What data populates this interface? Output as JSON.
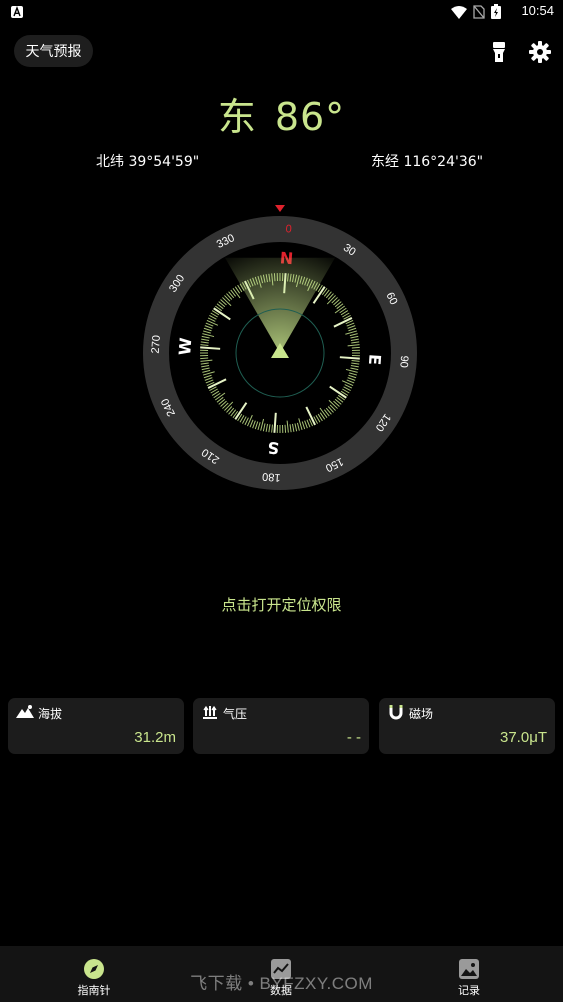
{
  "status_bar": {
    "time": "10:54"
  },
  "header": {
    "weather_label": "天气预报",
    "direction": "东",
    "degrees": "86°"
  },
  "coords": {
    "latitude": "北纬 39°54'59\"",
    "longitude": "东经 116°24'36\""
  },
  "compass": {
    "heading_deg": 86,
    "ring_numbers": [
      "0",
      "30",
      "60",
      "90",
      "120",
      "150",
      "180",
      "210",
      "240",
      "270",
      "300",
      "330"
    ],
    "cardinals": {
      "north": "N",
      "east": "E",
      "south": "S",
      "west": "W"
    }
  },
  "permission_text": "点击打开定位权限",
  "cards": [
    {
      "label": "海拔",
      "value": "31.2m",
      "icon": "mountain-icon"
    },
    {
      "label": "气压",
      "value": "- -",
      "icon": "pressure-icon"
    },
    {
      "label": "磁场",
      "value": "37.0μT",
      "icon": "magnet-icon"
    }
  ],
  "nav": {
    "items": [
      {
        "label": "指南针",
        "icon": "compass-icon"
      },
      {
        "label": "数据",
        "icon": "chart-icon"
      },
      {
        "label": "记录",
        "icon": "gallery-icon"
      }
    ]
  },
  "watermark": "飞下载 • BYFZXY.COM",
  "colors": {
    "accent": "#c9e58d",
    "north_red": "#e0222d",
    "ring": "#333333",
    "card_bg": "#1c1c1c"
  }
}
